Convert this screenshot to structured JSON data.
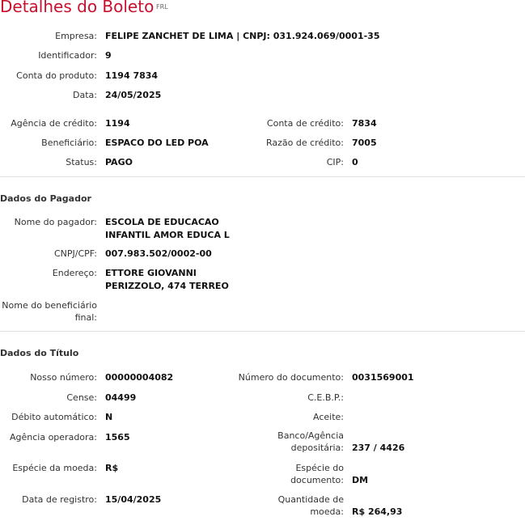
{
  "header": {
    "title": "Detalhes do Boleto",
    "badge": "FRL"
  },
  "top": {
    "empresa_label": "Empresa:",
    "empresa_value": "FELIPE ZANCHET DE LIMA | CNPJ: 031.924.069/0001-35",
    "identificador_label": "Identificador:",
    "identificador_value": "9",
    "conta_produto_label": "Conta do produto:",
    "conta_produto_value": "1194 7834",
    "data_label": "Data:",
    "data_value": "24/05/2025",
    "agencia_credito_label": "Agência de crédito:",
    "agencia_credito_value": "1194",
    "conta_credito_label": "Conta de crédito:",
    "conta_credito_value": "7834",
    "beneficiario_label": "Beneficiário:",
    "beneficiario_value": "ESPACO DO LED POA",
    "razao_credito_label": "Razão de crédito:",
    "razao_credito_value": "7005",
    "status_label": "Status:",
    "status_value": "PAGO",
    "cip_label": "CIP:",
    "cip_value": "0"
  },
  "pagador": {
    "section_title": "Dados do Pagador",
    "nome_label": "Nome do pagador:",
    "nome_line1": "ESCOLA DE EDUCACAO",
    "nome_line2": "INFANTIL AMOR EDUCA L",
    "cnpj_label": "CNPJ/CPF:",
    "cnpj_value": "007.983.502/0002-00",
    "endereco_label": "Endereço:",
    "endereco_line1": "ETTORE GIOVANNI",
    "endereco_line2": "PERIZZOLO, 474 TERREO",
    "beneficiario_final_label_line1": "Nome do beneficiário",
    "beneficiario_final_label_line2": "final:"
  },
  "titulo": {
    "section_title": "Dados do Título",
    "nosso_numero_label": "Nosso número:",
    "nosso_numero_value": "00000004082",
    "numero_documento_label": "Número do documento:",
    "numero_documento_value": "0031569001",
    "cense_label": "Cense:",
    "cense_value": "04499",
    "cebp_label": "C.E.B.P.:",
    "debito_label": "Débito automático:",
    "debito_value": "N",
    "aceite_label": "Aceite:",
    "agencia_operadora_label": "Agência operadora:",
    "agencia_operadora_value": "1565",
    "banco_agencia_label_line1": "Banco/Agência",
    "banco_agencia_label_line2": "depositária:",
    "banco_agencia_value": "237 / 4426",
    "especie_moeda_label": "Espécie da moeda:",
    "especie_moeda_value": "R$",
    "especie_doc_label_line1": "Espécie do",
    "especie_doc_label_line2": "documento:",
    "especie_doc_value": "DM",
    "data_registro_label": "Data de registro:",
    "data_registro_value": "15/04/2025",
    "quantidade_label_line1": "Quantidade de",
    "quantidade_label_line2": "moeda:",
    "quantidade_value": "R$ 264,93"
  }
}
